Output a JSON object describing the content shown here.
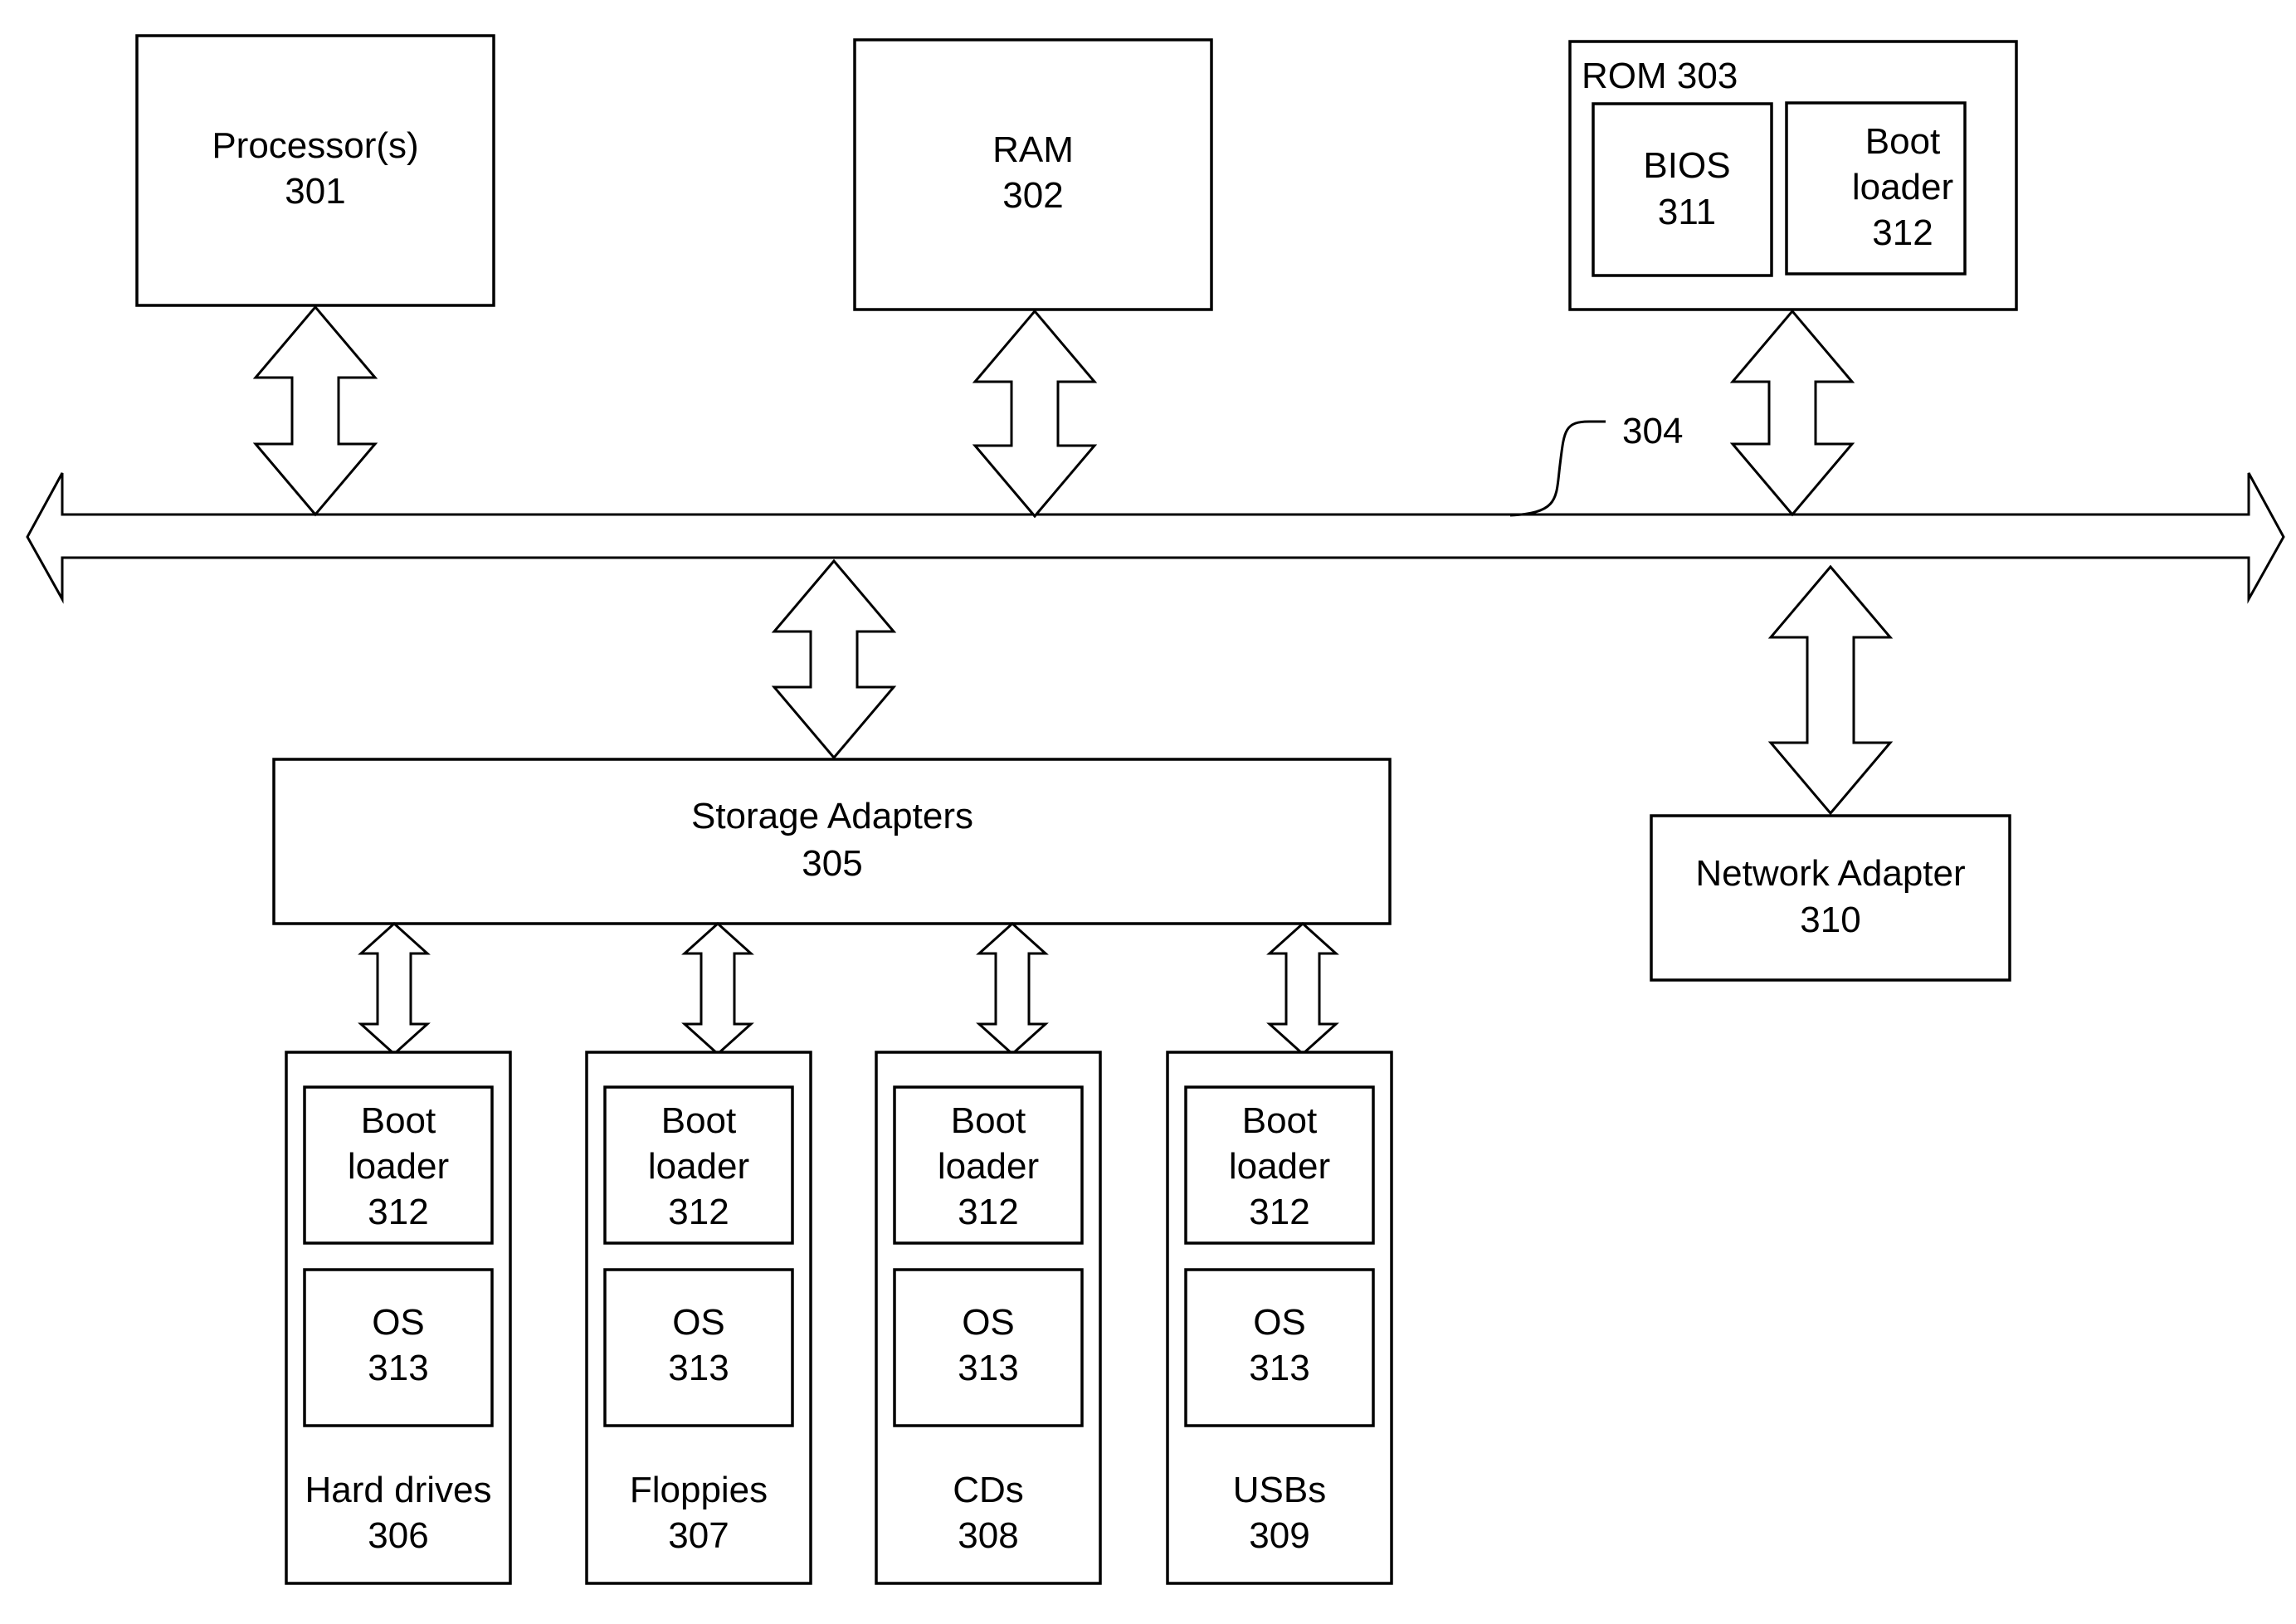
{
  "diagram": {
    "processor": {
      "name": "Processor(s)",
      "ref": "301"
    },
    "ram": {
      "name": "RAM",
      "ref": "302"
    },
    "rom": {
      "title": "ROM 303",
      "bios": {
        "name": "BIOS",
        "ref": "311"
      },
      "boot_loader": {
        "line1": "Boot",
        "line2": "loader",
        "ref": "312"
      }
    },
    "bus": {
      "ref": "304"
    },
    "storage_adapters": {
      "name": "Storage Adapters",
      "ref": "305"
    },
    "network_adapter": {
      "name": "Network Adapter",
      "ref": "310"
    },
    "devices": [
      {
        "name": "Hard drives",
        "ref": "306",
        "boot_line1": "Boot",
        "boot_line2": "loader",
        "boot_ref": "312",
        "os_name": "OS",
        "os_ref": "313"
      },
      {
        "name": "Floppies",
        "ref": "307",
        "boot_line1": "Boot",
        "boot_line2": "loader",
        "boot_ref": "312",
        "os_name": "OS",
        "os_ref": "313"
      },
      {
        "name": "CDs",
        "ref": "308",
        "boot_line1": "Boot",
        "boot_line2": "loader",
        "boot_ref": "312",
        "os_name": "OS",
        "os_ref": "313"
      },
      {
        "name": "USBs",
        "ref": "309",
        "boot_line1": "Boot",
        "boot_line2": "loader",
        "boot_ref": "312",
        "os_name": "OS",
        "os_ref": "313"
      }
    ]
  }
}
